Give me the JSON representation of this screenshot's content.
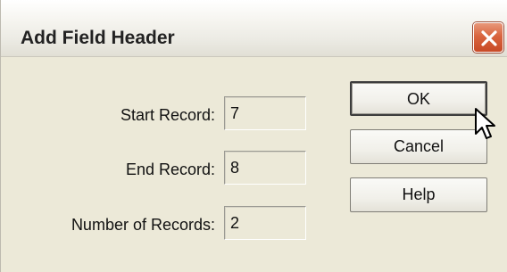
{
  "dialog": {
    "title": "Add Field Header",
    "close_icon": "close-x-icon",
    "fields": [
      {
        "label": "Start Record:",
        "value": "7"
      },
      {
        "label": "End Record:",
        "value": "8"
      },
      {
        "label": "Number of Records:",
        "value": "2"
      }
    ],
    "buttons": {
      "ok_label": "OK",
      "cancel_label": "Cancel",
      "help_label": "Help"
    }
  },
  "colors": {
    "dialog_background": "#ece9d8",
    "close_button": "#d9653f"
  }
}
